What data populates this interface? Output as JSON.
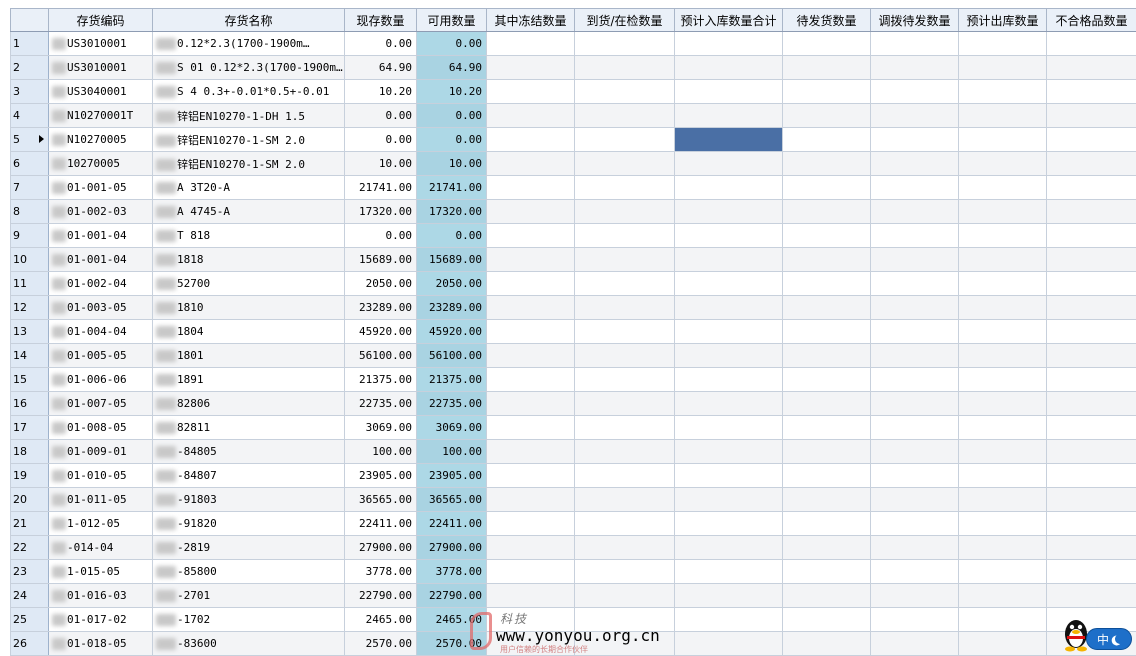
{
  "columns": {
    "rownum": "",
    "code": "存货编码",
    "name": "存货名称",
    "onhand": "现存数量",
    "available": "可用数量",
    "frozen": "其中冻结数量",
    "arrived": "到货/在检数量",
    "expected_in": "预计入库数量合计",
    "pending_ship": "待发货数量",
    "transfer_pending": "调拨待发数量",
    "expected_out": "预计出库数量",
    "defective": "不合格品数量"
  },
  "current_row_indicator": 5,
  "selected_cell": {
    "row": 5,
    "column": "expected_in"
  },
  "rows": [
    {
      "n": "1",
      "code": "US3010001",
      "name": "0.12*2.3(1700-1900m…",
      "onhand": "0.00",
      "available": "0.00"
    },
    {
      "n": "2",
      "code": "US3010001",
      "name": "S   01    0.12*2.3(1700-1900m…",
      "onhand": "64.90",
      "available": "64.90"
    },
    {
      "n": "3",
      "code": "US3040001",
      "name": "S   4  0.3+-0.01*0.5+-0.01",
      "onhand": "10.20",
      "available": "10.20"
    },
    {
      "n": "4",
      "code": "N10270001T",
      "name": "锌铝EN10270-1-DH 1.5",
      "onhand": "0.00",
      "available": "0.00"
    },
    {
      "n": "5",
      "code": "N10270005",
      "name": "锌铝EN10270-1-SM 2.0",
      "onhand": "0.00",
      "available": "0.00"
    },
    {
      "n": "6",
      "code": "10270005",
      "name": "锌铝EN10270-1-SM 2.0",
      "onhand": "10.00",
      "available": "10.00"
    },
    {
      "n": "7",
      "code": "01-001-05",
      "name": "A    3T20-A",
      "onhand": "21741.00",
      "available": "21741.00"
    },
    {
      "n": "8",
      "code": "01-002-03",
      "name": "A    4745-A",
      "onhand": "17320.00",
      "available": "17320.00"
    },
    {
      "n": "9",
      "code": "01-001-04",
      "name": "T    818",
      "onhand": "0.00",
      "available": "0.00"
    },
    {
      "n": "10",
      "code": "01-001-04",
      "name": "1818",
      "onhand": "15689.00",
      "available": "15689.00"
    },
    {
      "n": "11",
      "code": "01-002-04",
      "name": "52700",
      "onhand": "2050.00",
      "available": "2050.00"
    },
    {
      "n": "12",
      "code": "01-003-05",
      "name": "1810",
      "onhand": "23289.00",
      "available": "23289.00"
    },
    {
      "n": "13",
      "code": "01-004-04",
      "name": "1804",
      "onhand": "45920.00",
      "available": "45920.00"
    },
    {
      "n": "14",
      "code": "01-005-05",
      "name": "1801",
      "onhand": "56100.00",
      "available": "56100.00"
    },
    {
      "n": "15",
      "code": "01-006-06",
      "name": "1891",
      "onhand": "21375.00",
      "available": "21375.00"
    },
    {
      "n": "16",
      "code": "01-007-05",
      "name": "82806",
      "onhand": "22735.00",
      "available": "22735.00"
    },
    {
      "n": "17",
      "code": "01-008-05",
      "name": "82811",
      "onhand": "3069.00",
      "available": "3069.00"
    },
    {
      "n": "18",
      "code": "01-009-01",
      "name": "-84805",
      "onhand": "100.00",
      "available": "100.00"
    },
    {
      "n": "19",
      "code": "01-010-05",
      "name": "-84807",
      "onhand": "23905.00",
      "available": "23905.00"
    },
    {
      "n": "20",
      "code": "01-011-05",
      "name": "-91803",
      "onhand": "36565.00",
      "available": "36565.00"
    },
    {
      "n": "21",
      "code": "1-012-05",
      "name": "-91820",
      "onhand": "22411.00",
      "available": "22411.00"
    },
    {
      "n": "22",
      "code": "-014-04",
      "name": "-2819",
      "onhand": "27900.00",
      "available": "27900.00"
    },
    {
      "n": "23",
      "code": "1-015-05",
      "name": "-85800",
      "onhand": "3778.00",
      "available": "3778.00"
    },
    {
      "n": "24",
      "code": "01-016-03",
      "name": "-2701",
      "onhand": "22790.00",
      "available": "22790.00"
    },
    {
      "n": "25",
      "code": "01-017-02",
      "name": "-1702",
      "onhand": "2465.00",
      "available": "2465.00"
    },
    {
      "n": "26",
      "code": "01-018-05",
      "name": "-83600",
      "onhand": "2570.00",
      "available": "2570.00"
    }
  ],
  "watermark": {
    "brand_cn": "科技",
    "url": "www.yonyou.org.cn",
    "sub": "用户信赖的长期合作伙伴"
  },
  "ime": {
    "label": "中"
  },
  "colors": {
    "header_bg": "#eaf0f8",
    "available_col_bg": "#add8e6",
    "selected_cell_bg": "#4a6fa5",
    "ime_blue": "#1e6fc9"
  }
}
